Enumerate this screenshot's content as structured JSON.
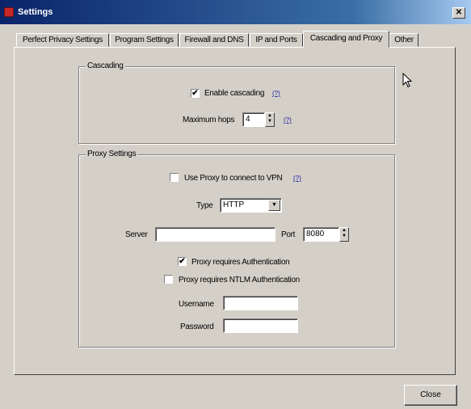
{
  "window": {
    "title": "Settings",
    "close_glyph": "✕"
  },
  "tabs": [
    {
      "label": "Perfect Privacy Settings"
    },
    {
      "label": "Program Settings"
    },
    {
      "label": "Firewall and DNS"
    },
    {
      "label": "IP and Ports"
    },
    {
      "label": "Cascading and Proxy",
      "active": true
    },
    {
      "label": "Other"
    }
  ],
  "cascading": {
    "legend": "Cascading",
    "enable_label": "Enable cascading",
    "enable_checked": true,
    "help": "(?)",
    "max_hops_label": "Maximum hops",
    "max_hops_value": "4"
  },
  "proxy": {
    "legend": "Proxy Settings",
    "use_proxy_label": "Use Proxy to connect to VPN",
    "use_proxy_checked": false,
    "help": "(?)",
    "type_label": "Type",
    "type_value": "HTTP",
    "server_label": "Server",
    "server_value": "",
    "port_label": "Port",
    "port_value": "8080",
    "auth_label": "Proxy requires Authentication",
    "auth_checked": true,
    "ntlm_label": "Proxy requires NTLM Authentication",
    "ntlm_checked": false,
    "username_label": "Username",
    "username_value": "",
    "password_label": "Password",
    "password_value": ""
  },
  "footer": {
    "close_label": "Close"
  },
  "checkmark": "✔",
  "icons": {
    "titlebar": "settings-app-icon",
    "close": "close-icon",
    "spin": "spin-arrows-icon",
    "dropdown": "chevron-down-icon",
    "cursor": "mouse-pointer-icon"
  },
  "colors": {
    "titlebar": "#0a246a",
    "window": "#d4d0c8",
    "link": "#1a1aa8"
  }
}
